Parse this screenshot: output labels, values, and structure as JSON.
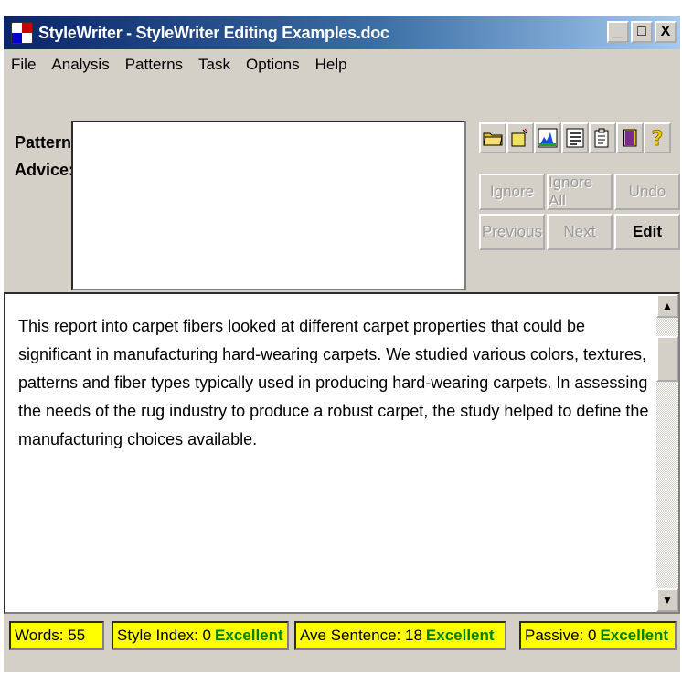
{
  "window": {
    "title": "StyleWriter - StyleWriter Editing Examples.doc",
    "buttons": {
      "minimize": "_",
      "maximize": "□",
      "close": "X"
    }
  },
  "menu": [
    "File",
    "Analysis",
    "Patterns",
    "Task",
    "Options",
    "Help"
  ],
  "labels": {
    "pattern": "Pattern:",
    "advice": "Advice:"
  },
  "toolbar_icons": [
    "open-folder-icon",
    "save-icon",
    "chart-icon",
    "list-icon",
    "clipboard-icon",
    "book-icon",
    "help-icon"
  ],
  "buttons": {
    "ignore": "Ignore",
    "ignore_all": "Ignore All",
    "undo": "Undo",
    "previous": "Previous",
    "next": "Next",
    "edit": "Edit"
  },
  "document": {
    "text": "This report into carpet fibers looked at different carpet properties that could be significant in manufacturing hard-wearing carpets.  We studied various colors, textures, patterns and fiber types typically used in producing hard-wearing carpets.   In assessing the needs of the rug industry to produce a robust carpet, the study helped to define the manufacturing choices available."
  },
  "status": {
    "words_label": "Words: 55",
    "style_index_label": "Style Index: 0",
    "style_index_value": "Excellent",
    "ave_sentence_label": "Ave Sentence: 18",
    "ave_sentence_value": "Excellent",
    "passive_label": "Passive: 0",
    "passive_value": "Excellent"
  },
  "colors": {
    "status_background": "#ffff00",
    "status_good": "#008000",
    "title_gradient_start": "#0a246a",
    "title_gradient_end": "#a6caf0"
  }
}
